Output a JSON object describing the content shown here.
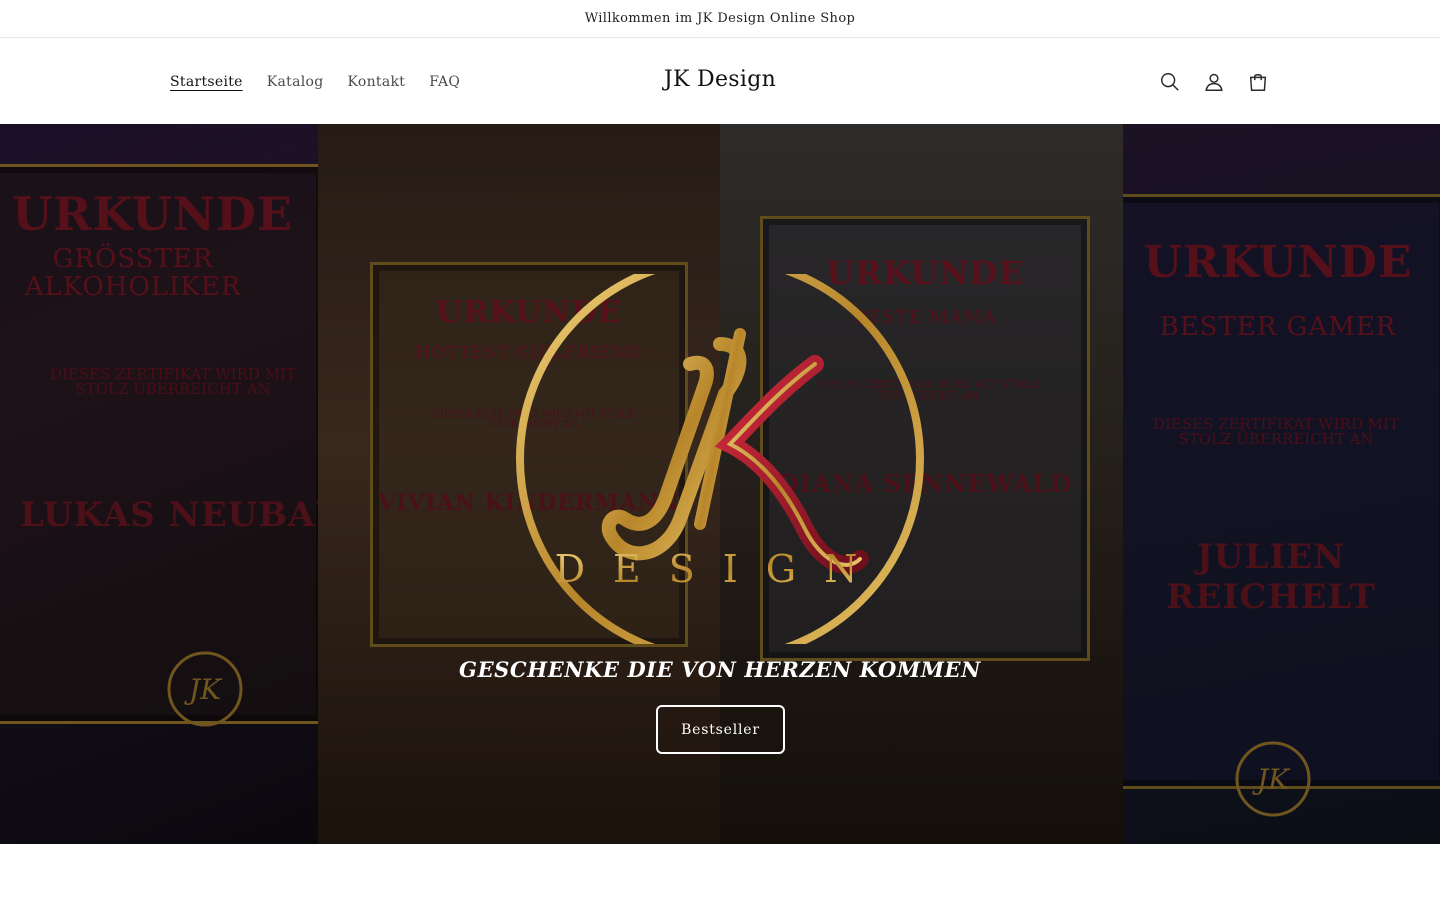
{
  "announcement": {
    "text": "Willkommen im JK Design Online Shop"
  },
  "header": {
    "logo": "JK Design",
    "nav": [
      {
        "label": "Startseite",
        "active": true
      },
      {
        "label": "Katalog",
        "active": false
      },
      {
        "label": "Kontakt",
        "active": false
      },
      {
        "label": "FAQ",
        "active": false
      }
    ],
    "icons": [
      "search-icon",
      "account-icon",
      "cart-icon"
    ]
  },
  "hero": {
    "title": "GESCHENKE DIE VON HERZEN KOMMEN",
    "button_label": "Bestseller",
    "emblem_text": "DESIGN",
    "certificates": [
      {
        "title": "URKUNDE",
        "subtitle": "GRÖSSTER ALKOHOLIKER",
        "line": "DIESES ZERTIFIKAT WIRD MIT STOLZ ÜBERREICHT AN",
        "name": "LUKAS NEUBAU"
      },
      {
        "title": "URKUNDE",
        "subtitle": "HOTTEST GIRLFRIEND",
        "line": "DIESES ZERTIFIKAT WIRD MIT STOLZ ÜBERREICHT AN",
        "name": "VIVIAN KINDERMANN"
      },
      {
        "title": "URKUNDE",
        "subtitle": "BESTE MAMA",
        "line": "DIESES ZERTIFIKAT WIRD MIT STOLZ ÜBERREICHT AN",
        "name": "DIANA SENNEWALD"
      },
      {
        "title": "URKUNDE",
        "subtitle": "BESTER GAMER",
        "line": "DIESES ZERTIFIKAT WIRD MIT STOLZ ÜBERREICHT AN",
        "name": "JULIEN REICHELT"
      }
    ],
    "colors": {
      "gold": "#c9a043",
      "crimson": "#8b1a2b",
      "overlay": "#000000"
    }
  }
}
